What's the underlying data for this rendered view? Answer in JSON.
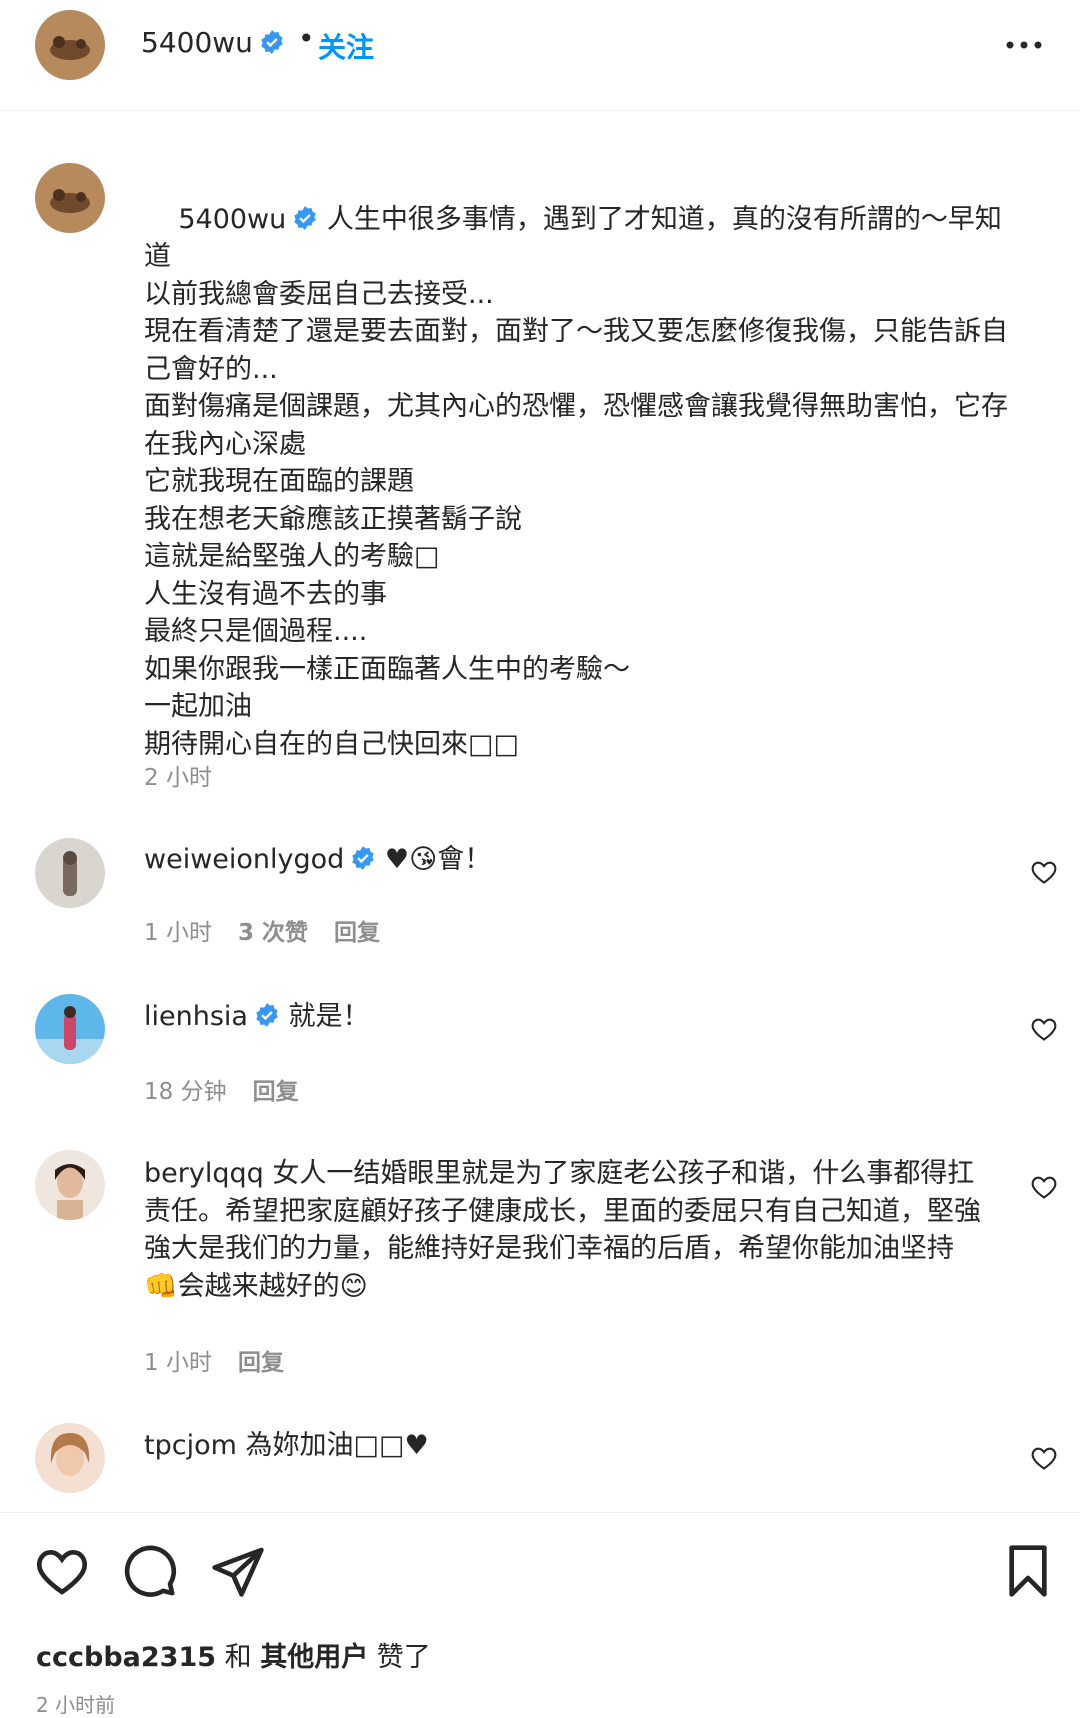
{
  "header": {
    "username": "5400wu",
    "dot": "•",
    "follow_label": "关注"
  },
  "caption": {
    "username": "5400wu",
    "text": "人生中很多事情，遇到了才知道，真的沒有所謂的～早知道\n以前我總會委屈自己去接受...\n現在看清楚了還是要去面對，面對了～我又要怎麼修復我傷，只能告訴自己會好的...\n面對傷痛是個課題，尤其內心的恐懼，恐懼感會讓我覺得無助害怕，它存在我內心深處\n它就我現在面臨的課題\n我在想老天爺應該正摸著鬍子說\n這就是給堅強人的考驗□\n人生沒有過不去的事\n最終只是個過程....\n如果你跟我一樣正面臨著人生中的考驗～\n一起加油\n期待開心自在的自己快回來□□",
    "time": "2 小时"
  },
  "comments": [
    {
      "username": "weiweionlygod",
      "text": "♥😘會！",
      "time": "1 小时",
      "likes": "3 次赞",
      "reply": "回复"
    },
    {
      "username": "lienhsia",
      "text": "就是！",
      "time": "18 分钟",
      "reply": "回复"
    },
    {
      "username": "berylqqq",
      "text": "女人一结婚眼里就是为了家庭老公孩子和谐，什么事都得扛责任。希望把家庭顧好孩子健康成长，里面的委屈只有自己知道，堅強強大是我们的力量，能維持好是我们幸福的后盾，希望你能加油坚持👊会越来越好的😊",
      "time": "1 小时",
      "reply": "回复"
    },
    {
      "username": "tpcjom",
      "text": "為妳加油□□♥"
    }
  ],
  "actions": {
    "liked_by_user": "cccbba2315",
    "liked_and": " 和 ",
    "liked_others": "其他用户",
    "liked_suffix": " 赞了",
    "post_time": "2 小时前"
  },
  "colors": {
    "link_blue": "#0095f6",
    "verified_blue": "#3897f0",
    "meta_grey": "#8e8e8e",
    "text": "#262626"
  },
  "icons": [
    "more-icon",
    "verified-badge-icon",
    "heart-icon",
    "comment-icon",
    "share-icon",
    "bookmark-icon"
  ]
}
